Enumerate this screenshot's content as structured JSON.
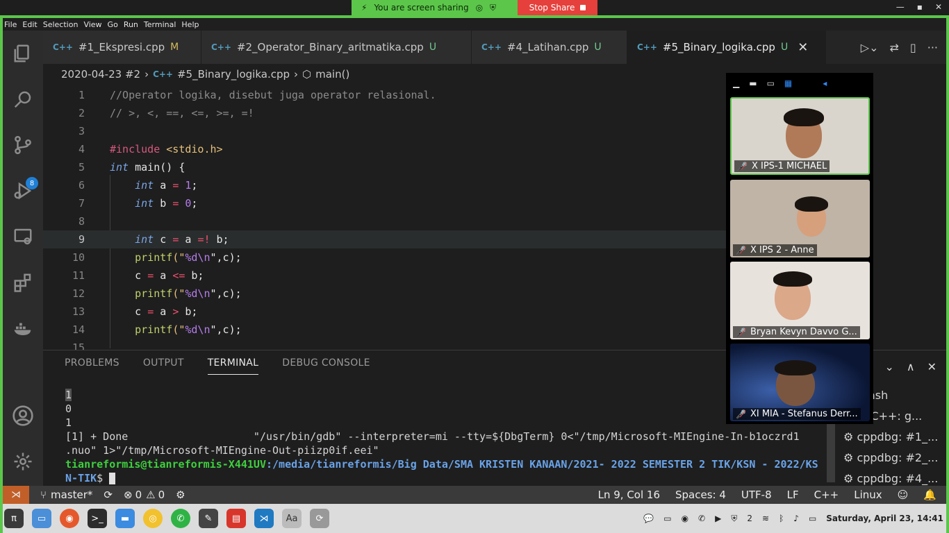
{
  "share": {
    "message": "You are screen sharing",
    "stop_label": "Stop Share",
    "brand_color": "#5cc64b",
    "stop_color": "#e5403b"
  },
  "menu": [
    "File",
    "Edit",
    "Selection",
    "View",
    "Go",
    "Run",
    "Terminal",
    "Help"
  ],
  "activity": {
    "scm_badge": "8"
  },
  "tabs": [
    {
      "name": "#1_Ekspresi.cpp",
      "status": "M"
    },
    {
      "name": "#2_Operator_Binary_aritmatika.cpp",
      "status": "U"
    },
    {
      "name": "#4_Latihan.cpp",
      "status": "U"
    },
    {
      "name": "#5_Binary_logika.cpp",
      "status": "U"
    }
  ],
  "file_icon_text": "C++",
  "breadcrumb": {
    "folder": "2020-04-23 #2",
    "file": "#5_Binary_logika.cpp",
    "symbol": "main()"
  },
  "editor": {
    "line_numbers": [
      "1",
      "2",
      "3",
      "4",
      "5",
      "6",
      "7",
      "8",
      "9",
      "10",
      "11",
      "12",
      "13",
      "14",
      "15"
    ],
    "l1": "//Operator logika, disebut juga operator relasional.",
    "l2": "// >, <, ==, <=, >=, =!",
    "l4_dir": "#include",
    "l4_hdr": "<stdio.h>",
    "kw_int": "int",
    "l5_rest": " main() {",
    "l6_var": " a ",
    "l6_val": "1",
    "l7_var": " b ",
    "l7_val": "0",
    "l9_var": " c ",
    "l9_a": " a ",
    "l9_op": "=!",
    "l9_b": " b;",
    "printf": "printf",
    "fmt_open": "(\"",
    "fmt_pct": "%d\\n",
    "fmt_close": "\",c);",
    "l11_c": "c ",
    "l11_a": " a ",
    "l11_op": "<=",
    "l11_b": " b;",
    "l13_op": ">",
    "assign": "=",
    "semi": ";"
  },
  "panel": {
    "tabs": [
      "PROBLEMS",
      "OUTPUT",
      "TERMINAL",
      "DEBUG CONSOLE"
    ],
    "active_tab": "TERMINAL",
    "output": [
      "1",
      "0",
      "1"
    ],
    "done_line": "[1] + Done                    \"/usr/bin/gdb\" --interpreter=mi --tty=${DbgTerm} 0<\"/tmp/Microsoft-MIEngine-In-b1oczrd1",
    "done_line2": ".nuo\" 1>\"/tmp/Microsoft-MIEngine-Out-piizp0if.eei\"",
    "prompt_user": "tianreformis@tianreformis-X441UV",
    "prompt_path": ":/media/tianreformis/Big Data/SMA KRISTEN KANAAN/2021- 2022 SEMESTER 2 TIK/KSN - 2022/KS",
    "prompt_path2": "N-TIK",
    "prompt_end": "$ ",
    "side_terminals": [
      "ash",
      "/C++: g...",
      "cppdbg: #1_...",
      "cppdbg: #2_...",
      "cppdbg: #4_..."
    ]
  },
  "status": {
    "branch": "master*",
    "errors": "0",
    "warnings": "0",
    "position": "Ln 9, Col 16",
    "spaces": "Spaces: 4",
    "encoding": "UTF-8",
    "eol": "LF",
    "language": "C++",
    "platform": "Linux"
  },
  "zoom": {
    "participants": [
      "X IPS-1 MICHAEL",
      "X IPS 2 - Anne",
      "Bryan Kevyn Davvo G...",
      "XI MIA - Stefanus Derr..."
    ]
  },
  "taskbar": {
    "clock": "Saturday, April 23, 14:41",
    "workspace": "2"
  }
}
